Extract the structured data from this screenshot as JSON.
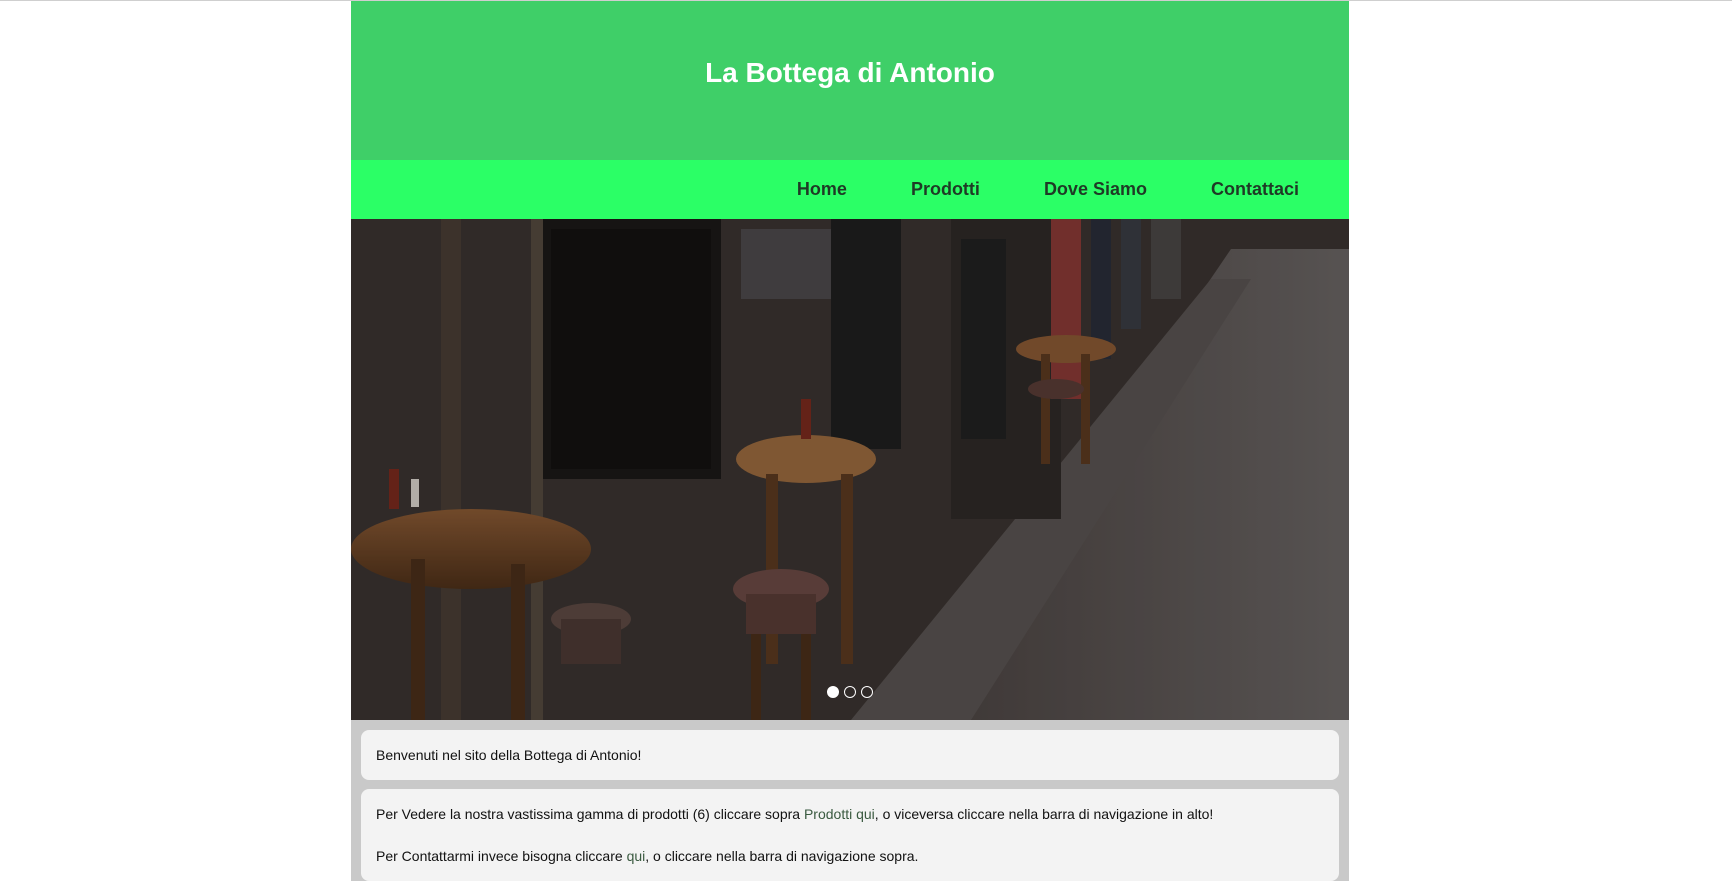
{
  "site": {
    "title": "La Bottega di Antonio"
  },
  "nav": {
    "items": [
      {
        "label": "Home"
      },
      {
        "label": "Prodotti"
      },
      {
        "label": "Dove Siamo"
      },
      {
        "label": "Contattaci"
      }
    ]
  },
  "hero": {
    "image_alt": "Café tables on a street sidewalk",
    "slides_total": 3,
    "active_slide": 1
  },
  "panels": {
    "welcome": "Benvenuti nel sito della Bottega di Antonio!",
    "products_text_1": "Per Vedere la nostra vastissima gamma di prodotti (6) cliccare sopra ",
    "products_link_label": "Prodotti",
    "products_link_here": "qui",
    "products_text_2": ", o viceversa cliccare nella barra di navigazione in alto!",
    "contact_text_1": "Per Contattarmi invece bisogna cliccare ",
    "contact_link_here": "qui",
    "contact_text_2": ", o cliccare nella barra di navigazione sopra."
  },
  "colors": {
    "header_bg": "#3fcf68",
    "nav_bg": "#2bff66",
    "nav_text": "#1f3a26",
    "content_bg": "#c9c9c9",
    "panel_bg": "#f3f3f3",
    "link": "#3a5a40"
  }
}
